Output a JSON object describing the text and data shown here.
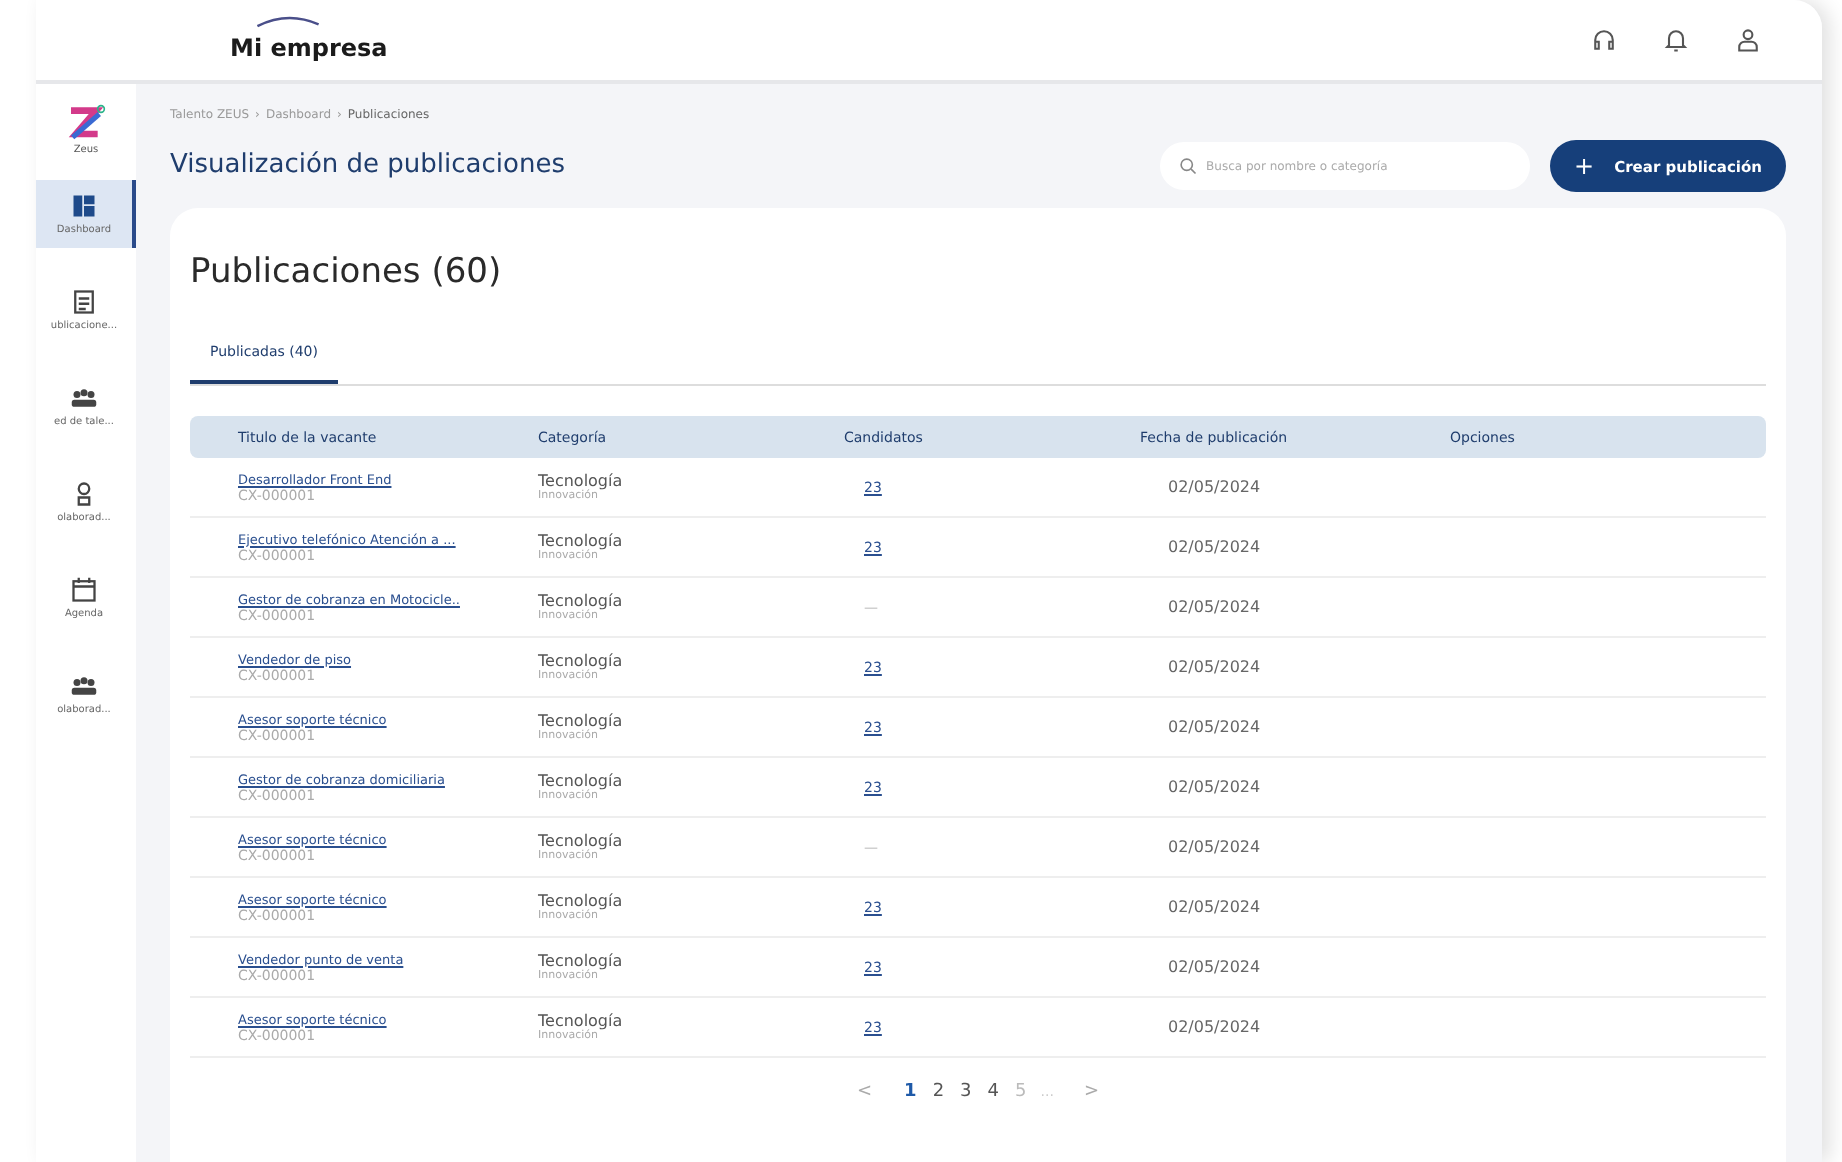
{
  "header": {
    "brand": "Mi empresa"
  },
  "sidebar": {
    "logo_label": "Zeus",
    "items": [
      {
        "label": "Dashboard",
        "kind": "dashboard",
        "selected": true
      },
      {
        "label": "ublicacione...",
        "kind": "document",
        "selected": false
      },
      {
        "label": "ed de tale...",
        "kind": "group",
        "selected": false
      },
      {
        "label": "olaborad...",
        "kind": "badge",
        "selected": false
      },
      {
        "label": "Agenda",
        "kind": "calendar",
        "selected": false
      },
      {
        "label": "olaborad...",
        "kind": "group",
        "selected": false
      }
    ]
  },
  "breadcrumb": {
    "separator": "›",
    "items": [
      "Talento ZEUS",
      "Dashboard",
      "Publicaciones"
    ]
  },
  "page_title": "Visualización de publicaciones",
  "search": {
    "placeholder": "Busca por nombre o categoría"
  },
  "create_button": {
    "label": "Crear publicación",
    "icon": "+"
  },
  "card": {
    "title": "Publicaciones (60)",
    "tabs": [
      {
        "label": "Publicadas (40)",
        "selected": true
      }
    ],
    "table": {
      "columns": [
        "Titulo de la vacante",
        "Categoría",
        "Candidatos",
        "Fecha de publicación",
        "Opciones"
      ],
      "rows": [
        {
          "title": "Desarrollador Front End",
          "code": "CX-000001",
          "category": "Tecnología",
          "subcategory": "Innovación",
          "candidates": "23",
          "has_candidates": true,
          "date": "02/05/2024"
        },
        {
          "title": "Ejecutivo telefónico Atención a ...",
          "code": "CX-000001",
          "category": "Tecnología",
          "subcategory": "Innovación",
          "candidates": "23",
          "has_candidates": true,
          "date": "02/05/2024"
        },
        {
          "title": "Gestor de cobranza en Motocicle..",
          "code": "CX-000001",
          "category": "Tecnología",
          "subcategory": "Innovación",
          "candidates": "—",
          "has_candidates": false,
          "date": "02/05/2024"
        },
        {
          "title": "Vendedor de piso",
          "code": "CX-000001",
          "category": "Tecnología",
          "subcategory": "Innovación",
          "candidates": "23",
          "has_candidates": true,
          "date": "02/05/2024"
        },
        {
          "title": "Asesor soporte técnico",
          "code": "CX-000001",
          "category": "Tecnología",
          "subcategory": "Innovación",
          "candidates": "23",
          "has_candidates": true,
          "date": "02/05/2024"
        },
        {
          "title": "Gestor de cobranza domiciliaria",
          "code": "CX-000001",
          "category": "Tecnología",
          "subcategory": "Innovación",
          "candidates": "23",
          "has_candidates": true,
          "date": "02/05/2024"
        },
        {
          "title": "Asesor soporte técnico",
          "code": "CX-000001",
          "category": "Tecnología",
          "subcategory": "Innovación",
          "candidates": "—",
          "has_candidates": false,
          "date": "02/05/2024"
        },
        {
          "title": "Asesor soporte técnico",
          "code": "CX-000001",
          "category": "Tecnología",
          "subcategory": "Innovación",
          "candidates": "23",
          "has_candidates": true,
          "date": "02/05/2024"
        },
        {
          "title": "Vendedor punto de venta",
          "code": "CX-000001",
          "category": "Tecnología",
          "subcategory": "Innovación",
          "candidates": "23",
          "has_candidates": true,
          "date": "02/05/2024"
        },
        {
          "title": "Asesor soporte técnico",
          "code": "CX-000001",
          "category": "Tecnología",
          "subcategory": "Innovación",
          "candidates": "23",
          "has_candidates": true,
          "date": "02/05/2024"
        }
      ]
    },
    "pagination": {
      "prev": "<",
      "next": ">",
      "ellipsis": "...",
      "pages": [
        {
          "label": "1",
          "selected": true,
          "faded": false
        },
        {
          "label": "2",
          "selected": false,
          "faded": false
        },
        {
          "label": "3",
          "selected": false,
          "faded": false
        },
        {
          "label": "4",
          "selected": false,
          "faded": false
        },
        {
          "label": "5",
          "selected": false,
          "faded": true
        }
      ]
    }
  }
}
